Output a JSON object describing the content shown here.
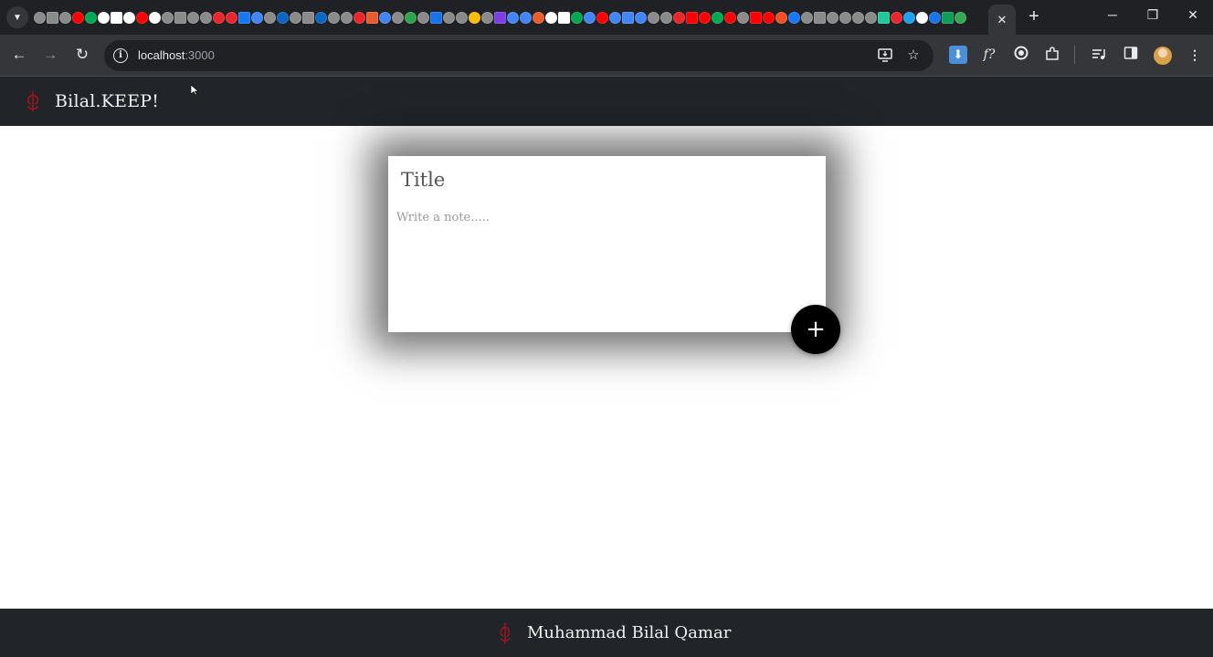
{
  "browser": {
    "tab_close": "✕",
    "new_tab": "+",
    "window": {
      "minimize": "─",
      "restore": "❐",
      "close": "✕"
    },
    "url_host": "localhost",
    "url_port": ":3000",
    "nav": {
      "back": "←",
      "forward": "→",
      "reload": "↻"
    },
    "extensions": [
      "download-helper-icon",
      "font-finder-icon",
      "circle-extension-icon",
      "puzzle-icon"
    ],
    "favicon_colors": [
      "#8a8a8a",
      "#8a8a8a",
      "#8a8a8a",
      "#ff0000",
      "#00a84f",
      "#ffffff",
      "#ffffff",
      "#ffffff",
      "#ff0000",
      "#ffffff",
      "#8a8a8a",
      "#8a8a8a",
      "#8a8a8a",
      "#8a8a8a",
      "#e8262b",
      "#e8262b",
      "#1877f2",
      "#4285f4",
      "#8a8a8a",
      "#0a66c2",
      "#8a8a8a",
      "#8a8a8a",
      "#0a66c2",
      "#8a8a8a",
      "#8a8a8a",
      "#e8262b",
      "#e85d2b",
      "#4285f4",
      "#8a8a8a",
      "#2ea44f",
      "#8a8a8a",
      "#1a73e8",
      "#8a8a8a",
      "#8a8a8a",
      "#fbbc04",
      "#8a8a8a",
      "#7b3fe4",
      "#4285f4",
      "#4285f4",
      "#e85d2b",
      "#ffffff",
      "#ffffff",
      "#00a84f",
      "#4285f4",
      "#ff0000",
      "#4285f4",
      "#4285f4",
      "#4285f4",
      "#8a8a8a",
      "#8a8a8a",
      "#e8262b",
      "#ff0000",
      "#ff0000",
      "#00a84f",
      "#ff0000",
      "#8a8a8a",
      "#ff0000",
      "#ff0000",
      "#f25022",
      "#1877f2",
      "#8a8a8a",
      "#8a8a8a",
      "#8a8a8a",
      "#8a8a8a",
      "#8a8a8a",
      "#8a8a8a",
      "#20c997",
      "#e8262b",
      "#1da1f2",
      "#ffffff",
      "#1a73e8",
      "#0f9d58",
      "#34a853"
    ]
  },
  "app": {
    "brand": "Bilal.KEEP!",
    "note_title_placeholder": "Title",
    "note_body_placeholder": "Write a note.....",
    "add_label": "+",
    "footer_text": "Muhammad Bilal Qamar",
    "colors": {
      "header_bg": "#212529",
      "icon_red": "#a0141e",
      "button_bg": "#000000"
    }
  }
}
